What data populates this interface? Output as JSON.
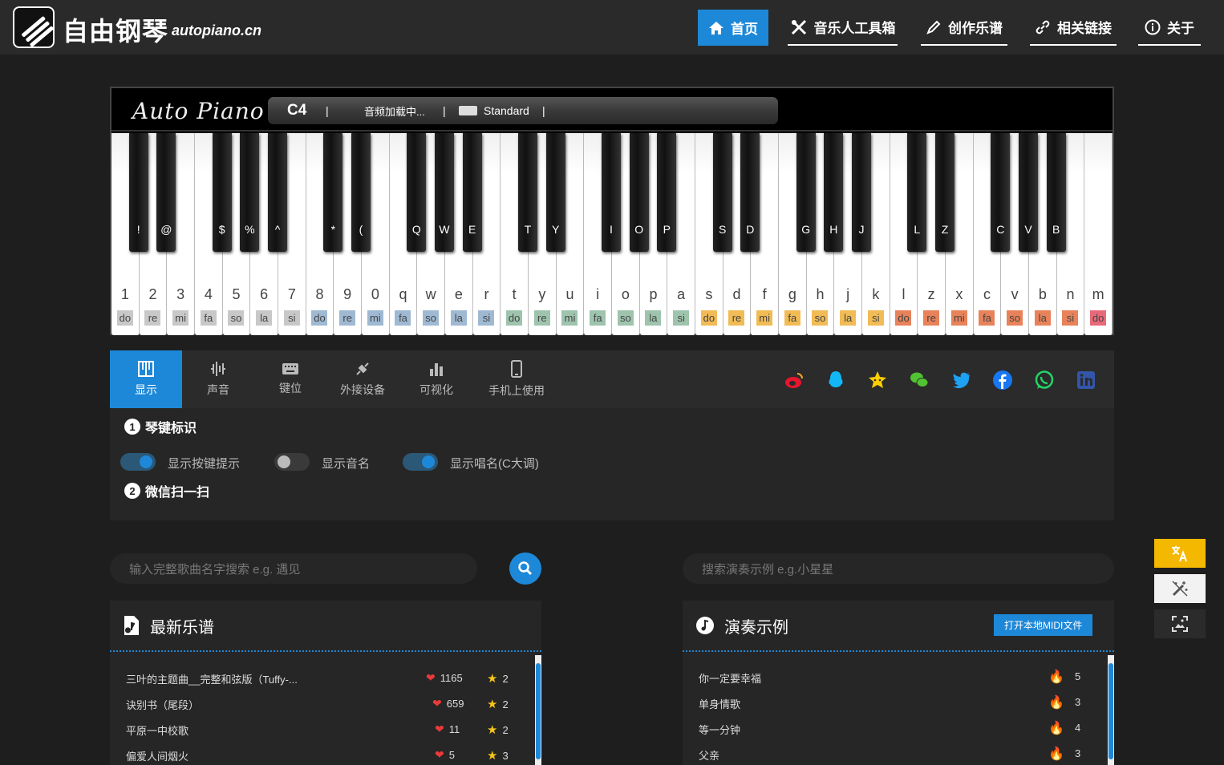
{
  "header": {
    "site_title": "自由钢琴",
    "site_domain": "autopiano.cn",
    "nav": [
      {
        "label": "首页",
        "icon": "home-icon",
        "active": true
      },
      {
        "label": "音乐人工具箱",
        "icon": "tools-icon"
      },
      {
        "label": "创作乐谱",
        "icon": "pen-icon"
      },
      {
        "label": "相关链接",
        "icon": "link-icon"
      },
      {
        "label": "关于",
        "icon": "info-icon"
      }
    ]
  },
  "piano": {
    "brand": "Auto Piano",
    "octave": "C4",
    "divider": "|",
    "audio_status": "音频加载中...",
    "keyboard_mode": "Standard",
    "keyboard_icon": "keyboard-icon",
    "white_keys": [
      {
        "char": "1",
        "solfege": "do"
      },
      {
        "char": "2",
        "solfege": "re"
      },
      {
        "char": "3",
        "solfege": "mi"
      },
      {
        "char": "4",
        "solfege": "fa"
      },
      {
        "char": "5",
        "solfege": "so"
      },
      {
        "char": "6",
        "solfege": "la"
      },
      {
        "char": "7",
        "solfege": "si"
      },
      {
        "char": "8",
        "solfege": "do"
      },
      {
        "char": "9",
        "solfege": "re"
      },
      {
        "char": "0",
        "solfege": "mi"
      },
      {
        "char": "q",
        "solfege": "fa"
      },
      {
        "char": "w",
        "solfege": "so"
      },
      {
        "char": "e",
        "solfege": "la"
      },
      {
        "char": "r",
        "solfege": "si"
      },
      {
        "char": "t",
        "solfege": "do"
      },
      {
        "char": "y",
        "solfege": "re"
      },
      {
        "char": "u",
        "solfege": "mi"
      },
      {
        "char": "i",
        "solfege": "fa"
      },
      {
        "char": "o",
        "solfege": "so"
      },
      {
        "char": "p",
        "solfege": "la"
      },
      {
        "char": "a",
        "solfege": "si"
      },
      {
        "char": "s",
        "solfege": "do"
      },
      {
        "char": "d",
        "solfege": "re"
      },
      {
        "char": "f",
        "solfege": "mi"
      },
      {
        "char": "g",
        "solfege": "fa"
      },
      {
        "char": "h",
        "solfege": "so"
      },
      {
        "char": "j",
        "solfege": "la"
      },
      {
        "char": "k",
        "solfege": "si"
      },
      {
        "char": "l",
        "solfege": "do"
      },
      {
        "char": "z",
        "solfege": "re"
      },
      {
        "char": "x",
        "solfege": "mi"
      },
      {
        "char": "c",
        "solfege": "fa"
      },
      {
        "char": "v",
        "solfege": "so"
      },
      {
        "char": "b",
        "solfege": "la"
      },
      {
        "char": "n",
        "solfege": "si"
      },
      {
        "char": "m",
        "solfege": "do"
      }
    ],
    "black_keys": [
      "!",
      "@",
      "$",
      "%",
      "^",
      "*",
      "(",
      "Q",
      "W",
      "E",
      "T",
      "Y",
      "I",
      "O",
      "P",
      "S",
      "D",
      "G",
      "H",
      "J",
      "L",
      "Z",
      "C",
      "V",
      "B"
    ],
    "octave_colors": [
      "#c8c8c8",
      "#9fb9d3",
      "#9ec4ae",
      "#f1bb55",
      "#e8825a",
      "#e86a7a"
    ]
  },
  "panel": {
    "tabs": [
      {
        "label": "显示",
        "icon": "piano-keys-icon",
        "active": true
      },
      {
        "label": "声音",
        "icon": "waveform-icon"
      },
      {
        "label": "键位",
        "icon": "keyboard-icon"
      },
      {
        "label": "外接设备",
        "icon": "plug-icon"
      },
      {
        "label": "可视化",
        "icon": "bar-chart-icon"
      },
      {
        "label": "手机上使用",
        "icon": "phone-icon"
      }
    ],
    "social": [
      "weibo-icon",
      "qq-icon",
      "qzone-icon",
      "wechat-icon",
      "twitter-icon",
      "facebook-icon",
      "whatsapp-icon",
      "linkedin-icon"
    ],
    "section1": {
      "num": "1",
      "title": "琴键标识"
    },
    "toggles": [
      {
        "label": "显示按键提示",
        "on": true
      },
      {
        "label": "显示音名",
        "on": false
      },
      {
        "label": "显示唱名(C大调)",
        "on": true
      }
    ],
    "section2": {
      "num": "2",
      "title": "微信扫一扫"
    }
  },
  "search": {
    "left_placeholder": "输入完整歌曲名字搜索  e.g. 遇见",
    "right_placeholder": "搜索演奏示例  e.g.小星星"
  },
  "latest": {
    "title": "最新乐谱",
    "rows": [
      {
        "name": "三叶的主题曲__完整和弦版（Tuffy-...",
        "likes": "1165",
        "stars": "2"
      },
      {
        "name": "诀别书（尾段）",
        "likes": "659",
        "stars": "2"
      },
      {
        "name": "平原一中校歌",
        "likes": "11",
        "stars": "2"
      },
      {
        "name": "偏爱人间烟火",
        "likes": "5",
        "stars": "3"
      }
    ]
  },
  "examples": {
    "title": "演奏示例",
    "button": "打开本地MIDI文件",
    "rows": [
      {
        "name": "你一定要幸福",
        "hot": "5"
      },
      {
        "name": "单身情歌",
        "hot": "3"
      },
      {
        "name": "等一分钟",
        "hot": "4"
      },
      {
        "name": "父亲",
        "hot": "3"
      }
    ]
  },
  "side_buttons": [
    "translate-icon",
    "magic-wand-icon",
    "image-icon"
  ],
  "colors": {
    "accent": "#1e88d8",
    "translate_btn": "#f5b800"
  }
}
